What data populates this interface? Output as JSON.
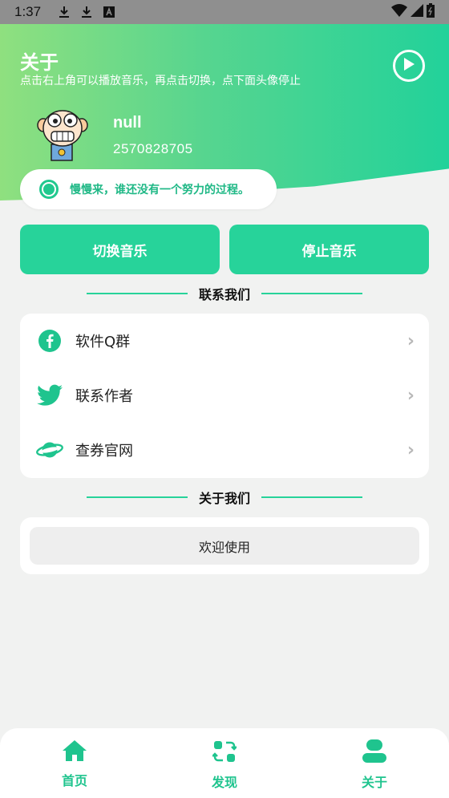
{
  "status_bar": {
    "time": "1:37",
    "icons": [
      "download-icon",
      "download-icon",
      "font-a-icon",
      "wifi-icon",
      "signal-icon",
      "battery-icon"
    ]
  },
  "header": {
    "title": "关于",
    "subtitle": "点击右上角可以播放音乐，再点击切换，点下面头像停止",
    "play_icon": "play-circle-icon"
  },
  "profile": {
    "name": "null",
    "id": "2570828705"
  },
  "motto": {
    "text": "慢慢来，谁还没有一个努力的过程。"
  },
  "actions": {
    "switch_label": "切换音乐",
    "stop_label": "停止音乐"
  },
  "contact": {
    "section_title": "联系我们",
    "items": [
      {
        "label": "软件Q群",
        "icon": "facebook-icon"
      },
      {
        "label": "联系作者",
        "icon": "twitter-icon"
      },
      {
        "label": "查券官网",
        "icon": "planet-icon"
      }
    ]
  },
  "about": {
    "section_title": "关于我们",
    "welcome": "欢迎使用"
  },
  "nav": {
    "items": [
      {
        "label": "首页",
        "icon": "home-icon"
      },
      {
        "label": "发现",
        "icon": "discover-icon"
      },
      {
        "label": "关于",
        "icon": "user-icon"
      }
    ]
  },
  "colors": {
    "accent": "#27d39a",
    "gradient_start": "#8fe07f",
    "gradient_end": "#22d29a"
  }
}
